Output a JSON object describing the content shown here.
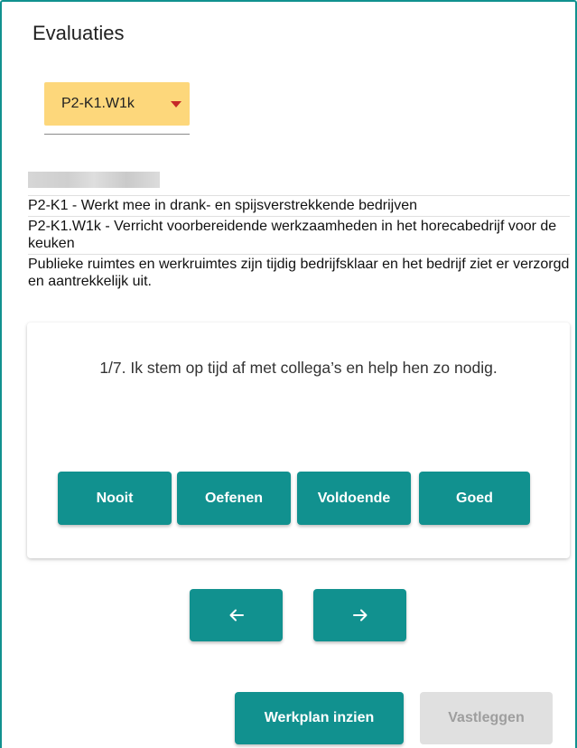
{
  "page": {
    "title": "Evaluaties"
  },
  "selector": {
    "value": "P2-K1.W1k",
    "caret_icon": "caret-down-icon"
  },
  "info_lines": [
    "P2-K1 - Werkt mee in drank- en spijsverstrekkende bedrijven",
    "P2-K1.W1k - Verricht voorbereidende werkzaamheden in het horecabedrijf voor de keuken",
    "Publieke ruimtes en werkruimtes zijn tijdig bedrijfsklaar en het bedrijf ziet er verzorgd en aantrekkelijk uit."
  ],
  "question": {
    "text": "1/7. Ik stem op tijd af met collega’s en help hen zo nodig.",
    "answers": [
      "Nooit",
      "Oefenen",
      "Voldoende",
      "Goed"
    ]
  },
  "navigation": {
    "prev_icon": "arrow-left-icon",
    "next_icon": "arrow-right-icon"
  },
  "actions": {
    "workplan_label": "Werkplan inzien",
    "save_label": "Vastleggen",
    "save_disabled": true
  },
  "colors": {
    "primary": "#11918f",
    "select_bg": "#fdd77b",
    "caret": "#c62828",
    "disabled_bg": "#e0e0e0",
    "disabled_text": "#9e9e9e"
  }
}
